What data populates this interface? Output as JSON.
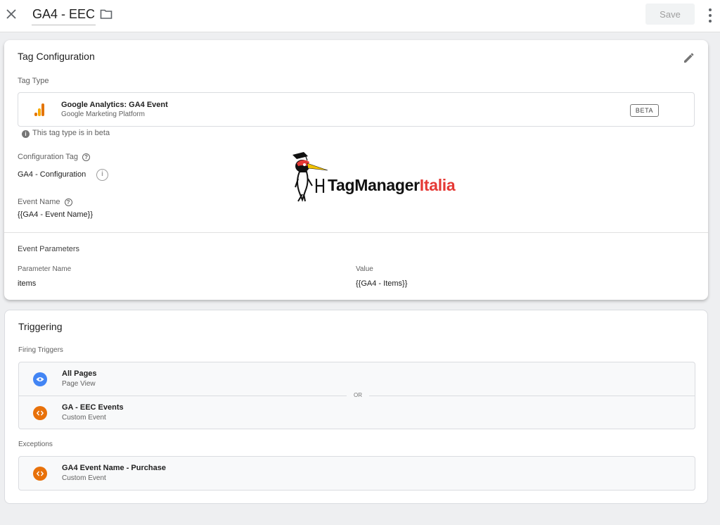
{
  "header": {
    "title": "GA4 - EEC",
    "save_label": "Save"
  },
  "tag_config": {
    "title": "Tag Configuration",
    "tag_type_label": "Tag Type",
    "tag_type_name": "Google Analytics: GA4 Event",
    "tag_type_sub": "Google Marketing Platform",
    "beta_badge": "BETA",
    "beta_note": "This tag type is in beta",
    "config_tag_label": "Configuration Tag",
    "config_tag_value": "GA4 - Configuration",
    "event_name_label": "Event Name",
    "event_name_value": "{{GA4 - Event Name}}",
    "event_params_label": "Event Parameters",
    "param_name_header": "Parameter Name",
    "param_value_header": "Value",
    "params": [
      {
        "name": "items",
        "value": "{{GA4 - Items}}"
      }
    ]
  },
  "watermark": {
    "brand_a": "TagManager",
    "brand_b": "Italia"
  },
  "triggering": {
    "title": "Triggering",
    "firing_label": "Firing Triggers",
    "or_label": "OR",
    "firing": [
      {
        "name": "All Pages",
        "type": "Page View",
        "icon": "eye-icon",
        "color": "#4285f4"
      },
      {
        "name": "GA - EEC Events",
        "type": "Custom Event",
        "icon": "code-icon",
        "color": "#e8710a"
      }
    ],
    "exceptions_label": "Exceptions",
    "exceptions": [
      {
        "name": "GA4 Event Name - Purchase",
        "type": "Custom Event",
        "icon": "code-icon",
        "color": "#e8710a"
      }
    ]
  }
}
